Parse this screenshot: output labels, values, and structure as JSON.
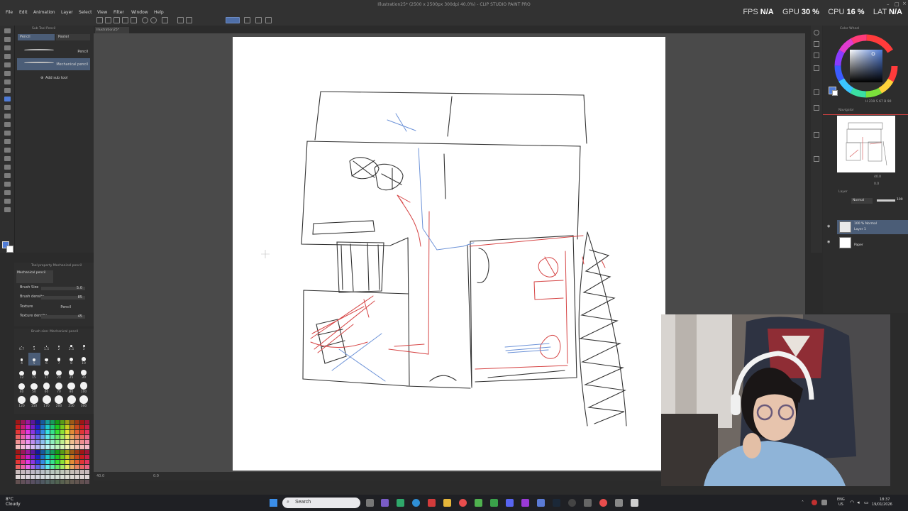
{
  "window": {
    "title": "Illustration25* (2500 x 2500px 300dpi 40.0%) - CLIP STUDIO PAINT PRO"
  },
  "menu": {
    "items": [
      "File",
      "Edit",
      "Animation",
      "Layer",
      "Select",
      "View",
      "Filter",
      "Window",
      "Help"
    ]
  },
  "stats": {
    "fps_label": "FPS",
    "fps_value": "N/A",
    "gpu_label": "GPU",
    "gpu_value": "30 %",
    "cpu_label": "CPU",
    "cpu_value": "16 %",
    "lat_label": "LAT",
    "lat_value": "N/A"
  },
  "document_tab": {
    "label": "Illustration25*"
  },
  "subtool": {
    "header": "Sub Tool Pencil",
    "tabs": [
      "Pencil",
      "Pastel"
    ],
    "brushes": [
      "Pencil",
      "Mechanical pencil"
    ],
    "add_label": "Add sub tool"
  },
  "tool_property": {
    "header": "Tool property Mechanical pencil",
    "preview_label": "Mechanical pencil",
    "rows": [
      {
        "label": "Brush Size",
        "value": "5.0"
      },
      {
        "label": "Brush density",
        "value": "85"
      },
      {
        "label": "Texture",
        "value": "Pencil"
      },
      {
        "label": "Texture density",
        "value": "45"
      }
    ]
  },
  "brush_size": {
    "header": "Brush size: Mechanical pencil",
    "sizes": [
      "0.7",
      "1",
      "1.5",
      "2",
      "2.5",
      "3",
      "4",
      "5",
      "6",
      "7",
      "8",
      "10",
      "12",
      "15",
      "17",
      "20",
      "25",
      "30",
      "40",
      "50",
      "60",
      "70",
      "80",
      "100",
      "120",
      "150",
      "170",
      "200",
      "250",
      "300"
    ]
  },
  "colors": {
    "main": "#4f7bd6",
    "sub": "#ffffff",
    "selected_brush_bg": "#4b5d77"
  },
  "panels": {
    "color_wheel": "Color Wheel",
    "color_values": "H 219  S 67  B 90",
    "navigator": "Navigator",
    "nav_zoom": "40.0",
    "nav_angle": "0.0",
    "layer_panel": "Layer",
    "blend_mode": "Normal",
    "opacity": "100"
  },
  "layers": [
    {
      "line1": "100 % Normal",
      "line2": "Layer 1",
      "selected": true
    },
    {
      "line1": "",
      "line2": "Paper",
      "selected": false
    }
  ],
  "statusbar": {
    "zoom": "40.0",
    "angle": "0.0"
  },
  "taskbar": {
    "weather_temp": "8°C",
    "weather_text": "Cloudy",
    "search_placeholder": "Search",
    "lang": "ENG",
    "region": "US",
    "time": "18:37",
    "date": "19/01/2026"
  }
}
